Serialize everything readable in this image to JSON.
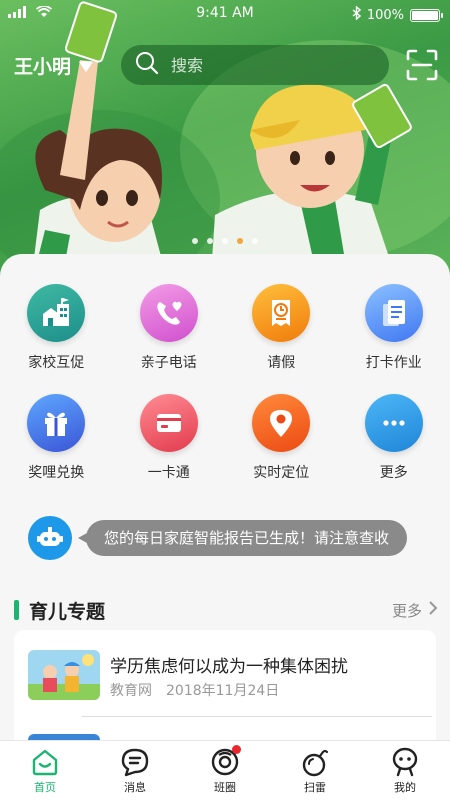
{
  "status_bar": {
    "time": "9:41 AM",
    "battery": "100%",
    "icons": [
      "signal-icon",
      "wifi-icon",
      "bluetooth-icon",
      "battery-icon"
    ]
  },
  "header": {
    "user_name": "王小明",
    "search_placeholder": "搜索"
  },
  "banner": {
    "slide_count": 5,
    "active_slide": 4
  },
  "features": [
    {
      "label": "家校互促",
      "icon": "school-icon",
      "color_from": "#3fb9a3",
      "color_to": "#1d8f8a"
    },
    {
      "label": "亲子电话",
      "icon": "phone-heart-icon",
      "color_from": "#f39de6",
      "color_to": "#d04fce"
    },
    {
      "label": "请假",
      "icon": "clock-doc-icon",
      "color_from": "#ffbf3b",
      "color_to": "#f07b0c"
    },
    {
      "label": "打卡作业",
      "icon": "documents-icon",
      "color_from": "#8cc0ff",
      "color_to": "#3f78f2"
    },
    {
      "label": "奖哩兑换",
      "icon": "gift-icon",
      "color_from": "#5ea7ff",
      "color_to": "#3a55d6"
    },
    {
      "label": "一卡通",
      "icon": "card-icon",
      "color_from": "#ff8c93",
      "color_to": "#e23b4d"
    },
    {
      "label": "实时定位",
      "icon": "location-pin-icon",
      "color_from": "#ff8a3c",
      "color_to": "#ec4a12"
    },
    {
      "label": "更多",
      "icon": "more-dots-icon",
      "color_from": "#4db6f7",
      "color_to": "#1f86d8"
    }
  ],
  "notice": {
    "text": "您的每日家庭智能报告已生成！请注意查收"
  },
  "section": {
    "title": "育儿专题",
    "more": "更多"
  },
  "articles": [
    {
      "title": "学历焦虑何以成为一种集体困扰",
      "source": "教育网",
      "date": "2018年11月24日"
    }
  ],
  "tabs": [
    {
      "label": "首页",
      "icon": "home-icon",
      "active": true
    },
    {
      "label": "消息",
      "icon": "message-icon",
      "active": false
    },
    {
      "label": "班圈",
      "icon": "circle-icon",
      "active": false,
      "badge": true
    },
    {
      "label": "扫雷",
      "icon": "bomb-icon",
      "active": false
    },
    {
      "label": "我的",
      "icon": "profile-icon",
      "active": false
    }
  ],
  "colors": {
    "accent": "#1bb571",
    "badge": "#e8262b",
    "banner_green": "#3b9a45",
    "active_dot": "#f1a640"
  }
}
